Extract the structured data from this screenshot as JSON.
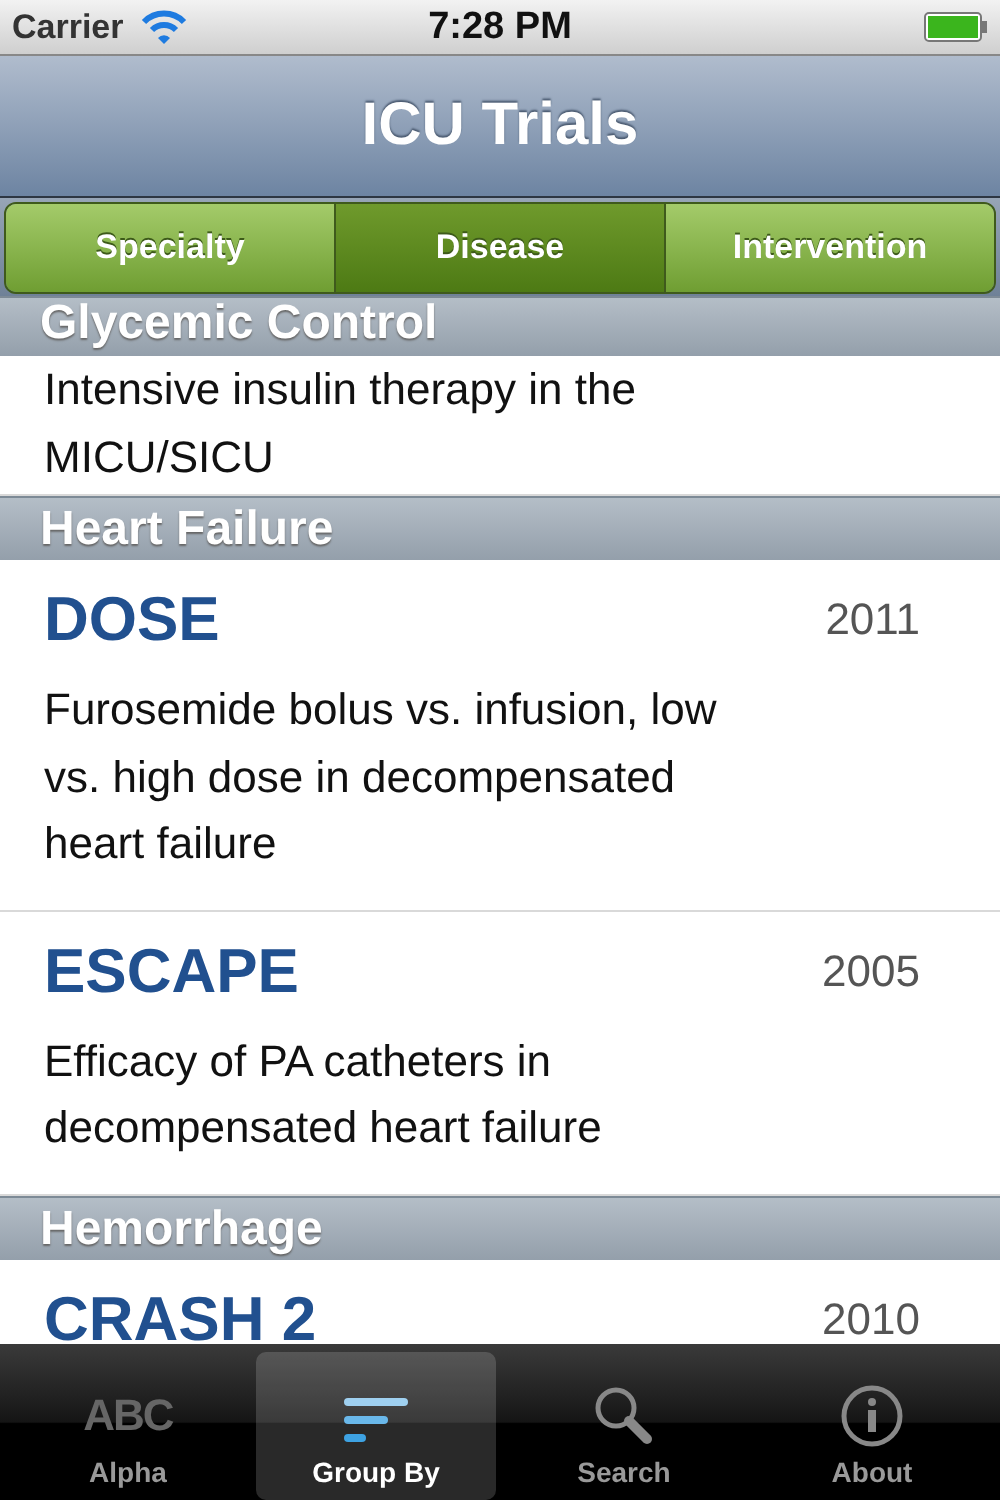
{
  "status_bar": {
    "carrier": "Carrier",
    "time": "7:28 PM"
  },
  "nav_bar": {
    "title": "ICU Trials"
  },
  "segments": [
    {
      "label": "Specialty",
      "selected": false
    },
    {
      "label": "Disease",
      "selected": true
    },
    {
      "label": "Intervention",
      "selected": false
    }
  ],
  "groups": [
    {
      "title": "Glycemic Control",
      "trials": [
        {
          "description": "Intensive insulin therapy in the MICU/SICU"
        }
      ]
    },
    {
      "title": "Heart Failure",
      "trials": [
        {
          "name": "DOSE",
          "year": "2011",
          "description": "Furosemide bolus vs. infusion, low vs. high dose in decompensated heart failure"
        },
        {
          "name": "ESCAPE",
          "year": "2005",
          "description": "Efficacy of PA catheters in decompensated heart failure"
        }
      ]
    },
    {
      "title": "Hemorrhage",
      "trials": [
        {
          "name": "CRASH 2",
          "year": "2010"
        }
      ]
    }
  ],
  "tab_bar": [
    {
      "kind": "letters",
      "glyph": "ABC",
      "label": "Alpha",
      "selected": false
    },
    {
      "kind": "groups",
      "label": "Group By",
      "selected": true
    },
    {
      "kind": "search",
      "label": "Search",
      "selected": false
    },
    {
      "kind": "info",
      "label": "About",
      "selected": false
    }
  ]
}
